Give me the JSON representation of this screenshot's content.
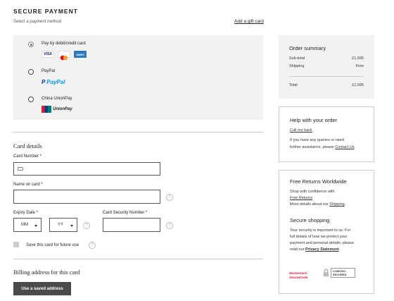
{
  "header": {
    "title": "SECURE PAYMENT",
    "subtitle": "Select a payment method",
    "gift_card_link": "Add a gift card"
  },
  "payment_methods": [
    {
      "label": "Pay by debit/credit card",
      "selected": true,
      "logos": [
        "VISA",
        "mastercard",
        "AMEX"
      ]
    },
    {
      "label": "PayPal",
      "selected": false,
      "logo": "PayPal"
    },
    {
      "label": "China UnionPay",
      "selected": false,
      "logo": "UnionPay"
    }
  ],
  "card_details": {
    "heading": "Card details",
    "card_number_label": "Card Number *",
    "name_label": "Name on card *",
    "expiry_label": "Expiry Date *",
    "month_value": "MM",
    "year_value": "YY",
    "security_label": "Card Security Number *",
    "save_card_label": "Save this card for future use",
    "help_glyph": "?"
  },
  "billing": {
    "heading": "Billing address for this card",
    "saved_address_button": "Use a saved address"
  },
  "order_summary": {
    "title": "Order summary",
    "rows": [
      {
        "label": "Sub-total",
        "value": "£1,595"
      },
      {
        "label": "Shipping",
        "value": "Free"
      }
    ],
    "total_label": "Total",
    "total_value": "£1,595"
  },
  "help_panel": {
    "title": "Help with your order",
    "call_link": "Call me back",
    "text_1": "If you have any queries or need",
    "text_2": "further assistance, please",
    "contact_link": "Contact Us",
    "text_2_end": "."
  },
  "returns_panel": {
    "title": "Free Returns Worldwide",
    "text_1": "Shop with confidence with",
    "free_returns_link": "Free Returns",
    "text_2": "More details about our",
    "shipping_link": "Shipping",
    "secure_title": "Secure shopping",
    "secure_1": "Your security is important to us. For",
    "secure_2": "full details of how we protect your",
    "secure_3": "payment and personal details, please",
    "secure_4": "read our",
    "privacy_link": "Privacy Statement",
    "badges": [
      "MasterCard. SecureCode",
      "COMODO SECURED"
    ]
  },
  "colors": {
    "panel_bg": "#f2f2f2",
    "button_bg": "#4a4a4a",
    "visa": "#1a1f71",
    "mastercard_red": "#eb001b",
    "mastercard_orange": "#f79e1b",
    "amex": "#2e77bb",
    "paypal_dark": "#003087",
    "paypal_light": "#009cde"
  }
}
